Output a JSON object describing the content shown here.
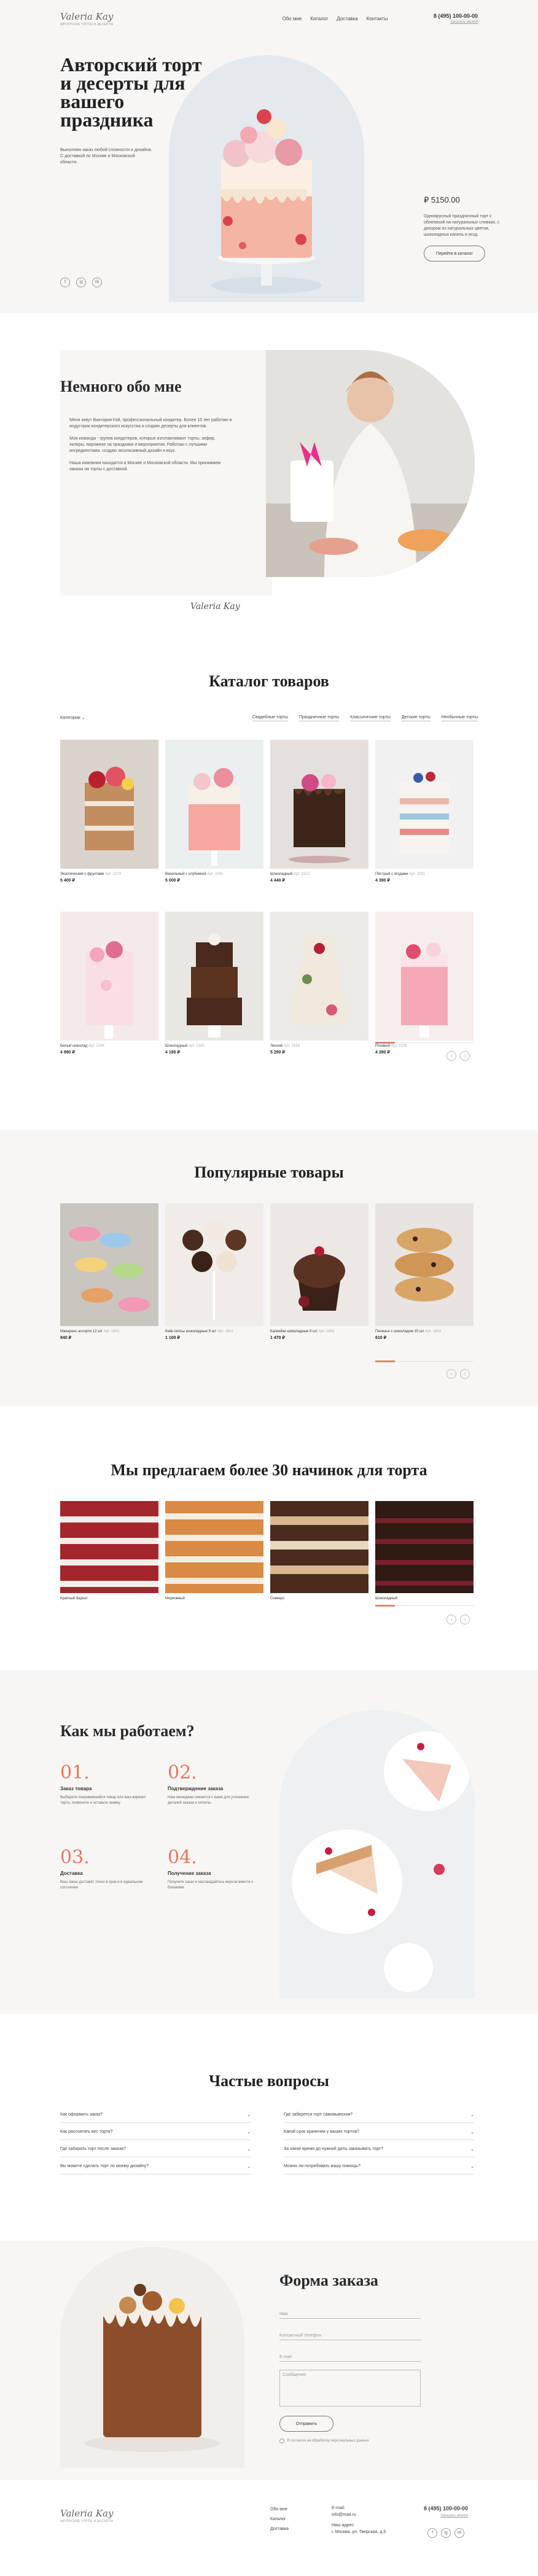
{
  "brand": {
    "logo": "Valeria Kay",
    "tagline": "АВТОРСКИЕ ТОРТЫ И ДЕСЕРТЫ"
  },
  "nav": [
    "Обо мне",
    "Каталог",
    "Доставка",
    "Контакты"
  ],
  "contact": {
    "phone": "8 (495) 100-00-00",
    "callback": "Заказать звонок"
  },
  "hero": {
    "title": "Авторский торт и десерты для вашего праздника",
    "description": "Выполняю заказ любой сложности и дизайна. С доставкой по Москве и Московской области.",
    "price": "₽ 5150.00",
    "product_description": "Одноярусный праздничный торт с облепихой на натуральных сливках, с декором из натуральных цветов, шоколадных капель и ягод.",
    "button": "Перейти в каталог",
    "socials": [
      "f",
      "ig",
      "vk"
    ]
  },
  "about": {
    "title": "Немного обо мне",
    "paragraphs": [
      "Меня зовут Виктория Кэй, профессиональный кондитер. Более 10 лет работаю в индустрии кондитерского искусства и создаю десерты для клиентов.",
      "Моя команда - группа кондитеров, которые изготавливают торты, зефир, эклеры, пирожное на праздники и мероприятия. Работаю с лучшими ингредиентами, создаю эксклюзивный дизайн и вкус.",
      "Наша компания находится в Москве и Московской области. Мы принимаем заказы на торты с доставкой."
    ],
    "signature": "Valeria Kay"
  },
  "catalog": {
    "title": "Каталог товаров",
    "category_label": "Категории",
    "filters": [
      "Свадебные торты",
      "Праздничные торты",
      "Классические торты",
      "Детские торты",
      "Необычные торты"
    ],
    "items": [
      {
        "name": "Экзотический с фруктами",
        "art": "Арт. 2278",
        "price": "5 400 ₽"
      },
      {
        "name": "Ванильный с клубникой",
        "art": "Арт. 2241",
        "price": "5 000 ₽"
      },
      {
        "name": "Шоколадный",
        "art": "Арт. 2213",
        "price": "4 440 ₽"
      },
      {
        "name": "Пёстрый с ягодами",
        "art": "Арт. 2201",
        "price": "4 390 ₽"
      },
      {
        "name": "Белый шоколад",
        "art": "Арт. 2194",
        "price": "4 990 ₽"
      },
      {
        "name": "Шоколадный",
        "art": "Арт. 2180",
        "price": "4 190 ₽"
      },
      {
        "name": "Лесной",
        "art": "Арт. 2168",
        "price": "5 290 ₽"
      },
      {
        "name": "Розовый",
        "art": "Арт. 2156",
        "price": "4 390 ₽"
      }
    ]
  },
  "popular": {
    "title": "Популярные товары",
    "items": [
      {
        "name": "Макаронс ассорти 12 шт",
        "art": "Арт. 1801",
        "price": "840 ₽"
      },
      {
        "name": "Кейк-попсы шоколадные 9 шт",
        "art": "Арт. 1802",
        "price": "1 100 ₽"
      },
      {
        "name": "Капкейки шоколадные 6 шт",
        "art": "Арт. 1803",
        "price": "1 470 ₽"
      },
      {
        "name": "Печенье с шоколадом 10 шт",
        "art": "Арт. 1804",
        "price": "610 ₽"
      }
    ]
  },
  "fillings": {
    "title": "Мы предлагаем более 30 начинок для торта",
    "items": [
      "Красный бархат",
      "Морковный",
      "Сникерс",
      "Шоколадный"
    ]
  },
  "how": {
    "title": "Как мы работаем?",
    "steps": [
      {
        "num": "01.",
        "title": "Заказ товара",
        "text": "Выберите понравившийся товар или ваш вариант торта, позвоните и оставьте заявку."
      },
      {
        "num": "02.",
        "title": "Подтверждение заказа",
        "text": "Наш менеджер свяжется с вами для уточнения деталей заказа и оплаты."
      },
      {
        "num": "03.",
        "title": "Доставка",
        "text": "Ваш заказ доставят точно в срок и в идеальном состоянии."
      },
      {
        "num": "04.",
        "title": "Получение заказа",
        "text": "Получите заказ и наслаждайтесь вкусом вместе с близкими."
      }
    ]
  },
  "faq": {
    "title": "Частые вопросы",
    "left": [
      "Как оформить заказ?",
      "Как рассчитать вес торта?",
      "Где забирать торт после заказа?",
      "Вы можете сделать торт по моему дизайну?"
    ],
    "right": [
      "Где заберется торт самовывозом?",
      "Какой срок хранения у ваших тортов?",
      "За какое время до нужной даты заказывать торт?",
      "Можно ли потребовать вашу помощь?"
    ]
  },
  "order": {
    "title": "Форма заказа",
    "fields": [
      "Имя",
      "Контактный телефон",
      "E-mail"
    ],
    "message": "Сообщение",
    "submit": "Отправить",
    "consent": "Я согласен на обработку персональных данных"
  },
  "footer": {
    "col1": [
      "Обо мне",
      "Каталог",
      "Доставка"
    ],
    "email_label": "E-mail:",
    "email": "info@mail.ru",
    "address_label": "Наш адрес:",
    "address": "г. Москва, ул. Тверская, д.5"
  }
}
